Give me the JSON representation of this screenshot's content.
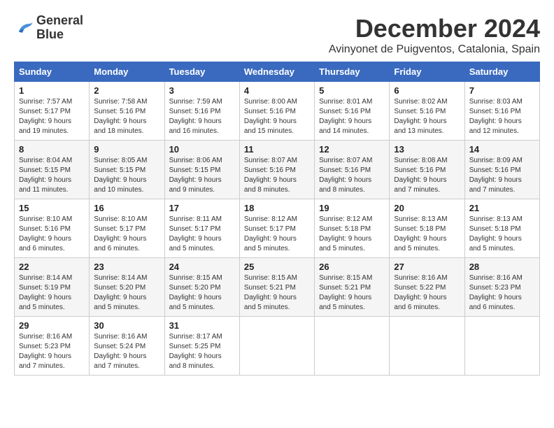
{
  "logo": {
    "line1": "General",
    "line2": "Blue"
  },
  "title": "December 2024",
  "location": "Avinyonet de Puigventos, Catalonia, Spain",
  "days_of_week": [
    "Sunday",
    "Monday",
    "Tuesday",
    "Wednesday",
    "Thursday",
    "Friday",
    "Saturday"
  ],
  "weeks": [
    [
      {
        "day": "1",
        "sunrise": "7:57 AM",
        "sunset": "5:17 PM",
        "daylight": "9 hours and 19 minutes."
      },
      {
        "day": "2",
        "sunrise": "7:58 AM",
        "sunset": "5:16 PM",
        "daylight": "9 hours and 18 minutes."
      },
      {
        "day": "3",
        "sunrise": "7:59 AM",
        "sunset": "5:16 PM",
        "daylight": "9 hours and 16 minutes."
      },
      {
        "day": "4",
        "sunrise": "8:00 AM",
        "sunset": "5:16 PM",
        "daylight": "9 hours and 15 minutes."
      },
      {
        "day": "5",
        "sunrise": "8:01 AM",
        "sunset": "5:16 PM",
        "daylight": "9 hours and 14 minutes."
      },
      {
        "day": "6",
        "sunrise": "8:02 AM",
        "sunset": "5:16 PM",
        "daylight": "9 hours and 13 minutes."
      },
      {
        "day": "7",
        "sunrise": "8:03 AM",
        "sunset": "5:16 PM",
        "daylight": "9 hours and 12 minutes."
      }
    ],
    [
      {
        "day": "8",
        "sunrise": "8:04 AM",
        "sunset": "5:15 PM",
        "daylight": "9 hours and 11 minutes."
      },
      {
        "day": "9",
        "sunrise": "8:05 AM",
        "sunset": "5:15 PM",
        "daylight": "9 hours and 10 minutes."
      },
      {
        "day": "10",
        "sunrise": "8:06 AM",
        "sunset": "5:15 PM",
        "daylight": "9 hours and 9 minutes."
      },
      {
        "day": "11",
        "sunrise": "8:07 AM",
        "sunset": "5:16 PM",
        "daylight": "9 hours and 8 minutes."
      },
      {
        "day": "12",
        "sunrise": "8:07 AM",
        "sunset": "5:16 PM",
        "daylight": "9 hours and 8 minutes."
      },
      {
        "day": "13",
        "sunrise": "8:08 AM",
        "sunset": "5:16 PM",
        "daylight": "9 hours and 7 minutes."
      },
      {
        "day": "14",
        "sunrise": "8:09 AM",
        "sunset": "5:16 PM",
        "daylight": "9 hours and 7 minutes."
      }
    ],
    [
      {
        "day": "15",
        "sunrise": "8:10 AM",
        "sunset": "5:16 PM",
        "daylight": "9 hours and 6 minutes."
      },
      {
        "day": "16",
        "sunrise": "8:10 AM",
        "sunset": "5:17 PM",
        "daylight": "9 hours and 6 minutes."
      },
      {
        "day": "17",
        "sunrise": "8:11 AM",
        "sunset": "5:17 PM",
        "daylight": "9 hours and 5 minutes."
      },
      {
        "day": "18",
        "sunrise": "8:12 AM",
        "sunset": "5:17 PM",
        "daylight": "9 hours and 5 minutes."
      },
      {
        "day": "19",
        "sunrise": "8:12 AM",
        "sunset": "5:18 PM",
        "daylight": "9 hours and 5 minutes."
      },
      {
        "day": "20",
        "sunrise": "8:13 AM",
        "sunset": "5:18 PM",
        "daylight": "9 hours and 5 minutes."
      },
      {
        "day": "21",
        "sunrise": "8:13 AM",
        "sunset": "5:18 PM",
        "daylight": "9 hours and 5 minutes."
      }
    ],
    [
      {
        "day": "22",
        "sunrise": "8:14 AM",
        "sunset": "5:19 PM",
        "daylight": "9 hours and 5 minutes."
      },
      {
        "day": "23",
        "sunrise": "8:14 AM",
        "sunset": "5:20 PM",
        "daylight": "9 hours and 5 minutes."
      },
      {
        "day": "24",
        "sunrise": "8:15 AM",
        "sunset": "5:20 PM",
        "daylight": "9 hours and 5 minutes."
      },
      {
        "day": "25",
        "sunrise": "8:15 AM",
        "sunset": "5:21 PM",
        "daylight": "9 hours and 5 minutes."
      },
      {
        "day": "26",
        "sunrise": "8:15 AM",
        "sunset": "5:21 PM",
        "daylight": "9 hours and 5 minutes."
      },
      {
        "day": "27",
        "sunrise": "8:16 AM",
        "sunset": "5:22 PM",
        "daylight": "9 hours and 6 minutes."
      },
      {
        "day": "28",
        "sunrise": "8:16 AM",
        "sunset": "5:23 PM",
        "daylight": "9 hours and 6 minutes."
      }
    ],
    [
      {
        "day": "29",
        "sunrise": "8:16 AM",
        "sunset": "5:23 PM",
        "daylight": "9 hours and 7 minutes."
      },
      {
        "day": "30",
        "sunrise": "8:16 AM",
        "sunset": "5:24 PM",
        "daylight": "9 hours and 7 minutes."
      },
      {
        "day": "31",
        "sunrise": "8:17 AM",
        "sunset": "5:25 PM",
        "daylight": "9 hours and 8 minutes."
      },
      null,
      null,
      null,
      null
    ]
  ],
  "labels": {
    "sunrise": "Sunrise:",
    "sunset": "Sunset:",
    "daylight": "Daylight:"
  }
}
